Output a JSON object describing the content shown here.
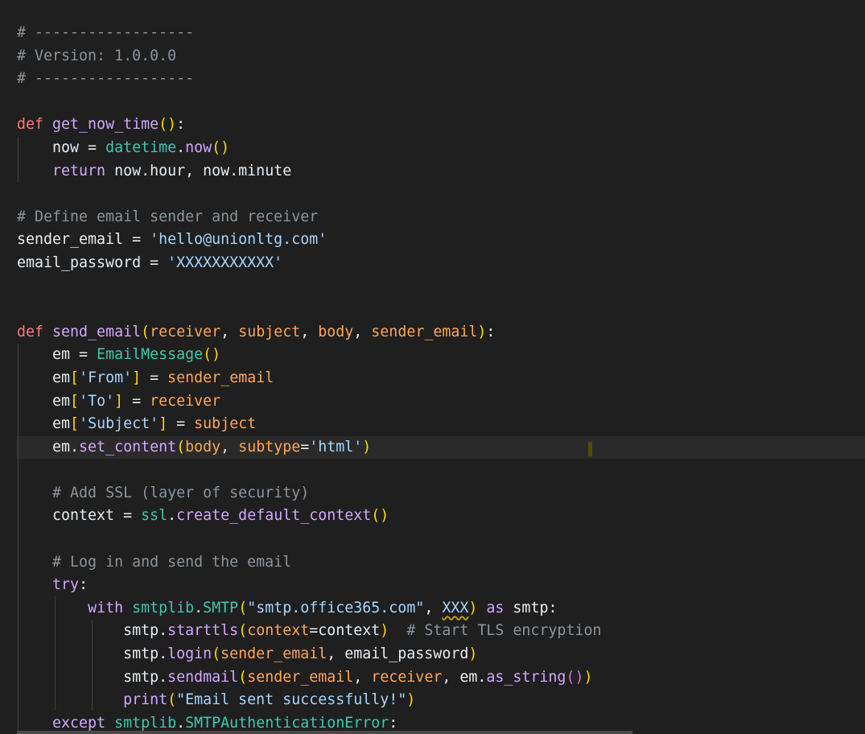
{
  "editor": {
    "language": "python",
    "lines": [
      {
        "tokens": [
          {
            "c": "tk-comment",
            "t": "# ------------------"
          }
        ]
      },
      {
        "tokens": [
          {
            "c": "tk-comment",
            "t": "# Version: 1.0.0.0"
          }
        ]
      },
      {
        "tokens": [
          {
            "c": "tk-comment",
            "t": "# ------------------"
          }
        ]
      },
      {
        "tokens": []
      },
      {
        "tokens": [
          {
            "c": "tk-kw",
            "t": "def "
          },
          {
            "c": "tk-fn",
            "t": "get_now_time"
          },
          {
            "c": "tk-br1",
            "t": "()"
          },
          {
            "c": "tk-plain",
            "t": ":"
          }
        ]
      },
      {
        "tokens": [
          {
            "c": "tk-plain",
            "t": "    now = "
          },
          {
            "c": "tk-mod",
            "t": "datetime"
          },
          {
            "c": "tk-plain",
            "t": "."
          },
          {
            "c": "tk-fn",
            "t": "now"
          },
          {
            "c": "tk-br1",
            "t": "()"
          }
        ]
      },
      {
        "tokens": [
          {
            "c": "tk-plain",
            "t": "    "
          },
          {
            "c": "tk-ctl",
            "t": "return"
          },
          {
            "c": "tk-plain",
            "t": " now.hour, now.minute"
          }
        ]
      },
      {
        "tokens": []
      },
      {
        "tokens": [
          {
            "c": "tk-comment",
            "t": "# Define email sender and receiver"
          }
        ]
      },
      {
        "tokens": [
          {
            "c": "tk-plain",
            "t": "sender_email = "
          },
          {
            "c": "tk-str",
            "t": "'hello@unionltg.com'"
          }
        ]
      },
      {
        "tokens": [
          {
            "c": "tk-plain",
            "t": "email_password = "
          },
          {
            "c": "tk-str",
            "t": "'XXXXXXXXXXX'"
          }
        ]
      },
      {
        "tokens": []
      },
      {
        "tokens": []
      },
      {
        "tokens": [
          {
            "c": "tk-kw",
            "t": "def "
          },
          {
            "c": "tk-fn",
            "t": "send_email"
          },
          {
            "c": "tk-br1",
            "t": "("
          },
          {
            "c": "tk-param",
            "t": "receiver"
          },
          {
            "c": "tk-plain",
            "t": ", "
          },
          {
            "c": "tk-param",
            "t": "subject"
          },
          {
            "c": "tk-plain",
            "t": ", "
          },
          {
            "c": "tk-param",
            "t": "body"
          },
          {
            "c": "tk-plain",
            "t": ", "
          },
          {
            "c": "tk-param",
            "t": "sender_email"
          },
          {
            "c": "tk-br1",
            "t": ")"
          },
          {
            "c": "tk-plain",
            "t": ":"
          }
        ]
      },
      {
        "tokens": [
          {
            "c": "tk-plain",
            "t": "    em = "
          },
          {
            "c": "tk-mod",
            "t": "EmailMessage"
          },
          {
            "c": "tk-br1",
            "t": "()"
          }
        ]
      },
      {
        "tokens": [
          {
            "c": "tk-plain",
            "t": "    em"
          },
          {
            "c": "tk-br1",
            "t": "["
          },
          {
            "c": "tk-str",
            "t": "'From'"
          },
          {
            "c": "tk-br1",
            "t": "]"
          },
          {
            "c": "tk-plain",
            "t": " = "
          },
          {
            "c": "tk-param",
            "t": "sender_email"
          }
        ]
      },
      {
        "tokens": [
          {
            "c": "tk-plain",
            "t": "    em"
          },
          {
            "c": "tk-br1",
            "t": "["
          },
          {
            "c": "tk-str",
            "t": "'To'"
          },
          {
            "c": "tk-br1",
            "t": "]"
          },
          {
            "c": "tk-plain",
            "t": " = "
          },
          {
            "c": "tk-param",
            "t": "receiver"
          }
        ]
      },
      {
        "tokens": [
          {
            "c": "tk-plain",
            "t": "    em"
          },
          {
            "c": "tk-br1",
            "t": "["
          },
          {
            "c": "tk-str",
            "t": "'Subject'"
          },
          {
            "c": "tk-br1",
            "t": "]"
          },
          {
            "c": "tk-plain",
            "t": " = "
          },
          {
            "c": "tk-param",
            "t": "subject"
          }
        ]
      },
      {
        "current": true,
        "tokens": [
          {
            "c": "tk-plain",
            "t": "    em."
          },
          {
            "c": "tk-fn",
            "t": "set_content"
          },
          {
            "c": "tk-br1",
            "t": "("
          },
          {
            "c": "tk-param",
            "t": "body"
          },
          {
            "c": "tk-plain",
            "t": ", "
          },
          {
            "c": "tk-param",
            "t": "subtype"
          },
          {
            "c": "tk-plain",
            "t": "="
          },
          {
            "c": "tk-str",
            "t": "'html'"
          },
          {
            "c": "tk-br1",
            "t": ")"
          }
        ]
      },
      {
        "tokens": []
      },
      {
        "tokens": [
          {
            "c": "tk-plain",
            "t": "    "
          },
          {
            "c": "tk-comment",
            "t": "# Add SSL (layer of security)"
          }
        ]
      },
      {
        "tokens": [
          {
            "c": "tk-plain",
            "t": "    context = "
          },
          {
            "c": "tk-mod",
            "t": "ssl"
          },
          {
            "c": "tk-plain",
            "t": "."
          },
          {
            "c": "tk-fn",
            "t": "create_default_context"
          },
          {
            "c": "tk-br1",
            "t": "()"
          }
        ]
      },
      {
        "tokens": []
      },
      {
        "tokens": [
          {
            "c": "tk-plain",
            "t": "    "
          },
          {
            "c": "tk-comment",
            "t": "# Log in and send the email"
          }
        ]
      },
      {
        "tokens": [
          {
            "c": "tk-plain",
            "t": "    "
          },
          {
            "c": "tk-ctl",
            "t": "try"
          },
          {
            "c": "tk-plain",
            "t": ":"
          }
        ]
      },
      {
        "tokens": [
          {
            "c": "tk-plain",
            "t": "        "
          },
          {
            "c": "tk-ctl",
            "t": "with "
          },
          {
            "c": "tk-mod",
            "t": "smtplib"
          },
          {
            "c": "tk-plain",
            "t": "."
          },
          {
            "c": "tk-mod",
            "t": "SMTP"
          },
          {
            "c": "tk-br1",
            "t": "("
          },
          {
            "c": "tk-str",
            "t": "\"smtp.office365.com\""
          },
          {
            "c": "tk-plain",
            "t": ", "
          },
          {
            "c": "tk-str squiggle",
            "t": "XXX"
          },
          {
            "c": "tk-br1",
            "t": ")"
          },
          {
            "c": "tk-ctl",
            "t": " as"
          },
          {
            "c": "tk-plain",
            "t": " smtp:"
          }
        ]
      },
      {
        "tokens": [
          {
            "c": "tk-plain",
            "t": "            smtp."
          },
          {
            "c": "tk-fn",
            "t": "starttls"
          },
          {
            "c": "tk-br1",
            "t": "("
          },
          {
            "c": "tk-param",
            "t": "context"
          },
          {
            "c": "tk-plain",
            "t": "=context"
          },
          {
            "c": "tk-br1",
            "t": ")"
          },
          {
            "c": "tk-plain",
            "t": "  "
          },
          {
            "c": "tk-comment",
            "t": "# Start TLS encryption"
          }
        ]
      },
      {
        "tokens": [
          {
            "c": "tk-plain",
            "t": "            smtp."
          },
          {
            "c": "tk-fn",
            "t": "login"
          },
          {
            "c": "tk-br1",
            "t": "("
          },
          {
            "c": "tk-param",
            "t": "sender_email"
          },
          {
            "c": "tk-plain",
            "t": ", email_password"
          },
          {
            "c": "tk-br1",
            "t": ")"
          }
        ]
      },
      {
        "tokens": [
          {
            "c": "tk-plain",
            "t": "            smtp."
          },
          {
            "c": "tk-fn",
            "t": "sendmail"
          },
          {
            "c": "tk-br1",
            "t": "("
          },
          {
            "c": "tk-param",
            "t": "sender_email"
          },
          {
            "c": "tk-plain",
            "t": ", "
          },
          {
            "c": "tk-param",
            "t": "receiver"
          },
          {
            "c": "tk-plain",
            "t": ", em."
          },
          {
            "c": "tk-fn",
            "t": "as_string"
          },
          {
            "c": "tk-br2",
            "t": "()"
          },
          {
            "c": "tk-br1",
            "t": ")"
          }
        ]
      },
      {
        "tokens": [
          {
            "c": "tk-plain",
            "t": "            "
          },
          {
            "c": "tk-fn",
            "t": "print"
          },
          {
            "c": "tk-br1",
            "t": "("
          },
          {
            "c": "tk-str",
            "t": "\"Email sent successfully!\""
          },
          {
            "c": "tk-br1",
            "t": ")"
          }
        ]
      },
      {
        "tokens": [
          {
            "c": "tk-plain",
            "t": "    "
          },
          {
            "c": "tk-ctl",
            "t": "except "
          },
          {
            "c": "tk-mod",
            "t": "smtplib"
          },
          {
            "c": "tk-plain",
            "t": "."
          },
          {
            "c": "tk-mod",
            "t": "SMTPAuthenticationError"
          },
          {
            "c": "tk-plain",
            "t": ":"
          }
        ]
      }
    ]
  }
}
